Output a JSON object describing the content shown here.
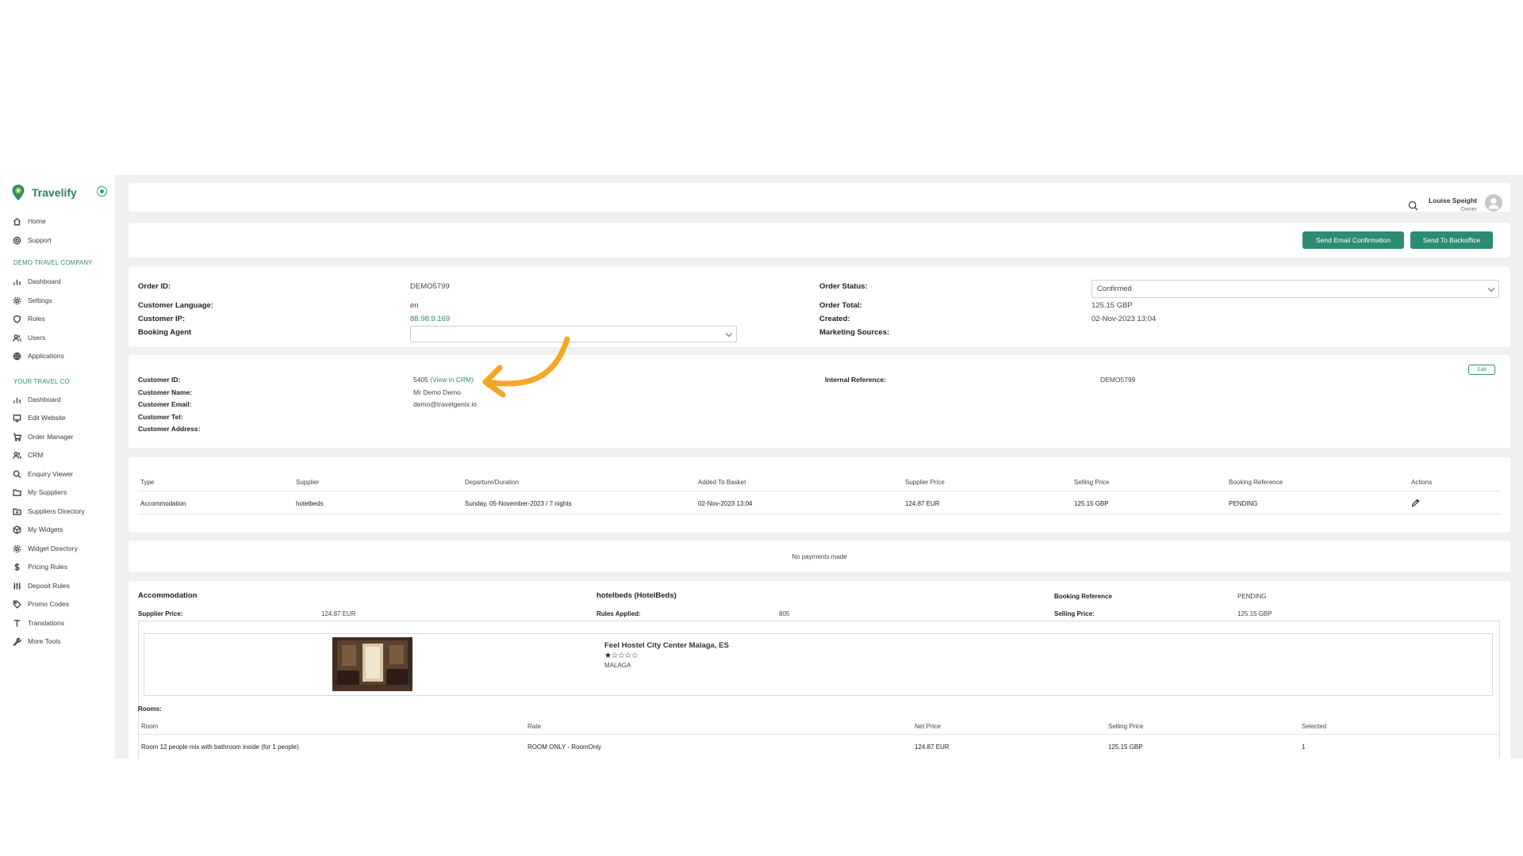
{
  "brand": {
    "name": "Travelify"
  },
  "sidebar": {
    "top_items": [
      {
        "label": "Home",
        "icon": "home-icon"
      },
      {
        "label": "Support",
        "icon": "support-icon"
      }
    ],
    "section1": {
      "title": "DEMO TRAVEL COMPANY",
      "items": [
        {
          "label": "Dashboard",
          "icon": "bar-chart-icon"
        },
        {
          "label": "Settings",
          "icon": "gear-icon"
        },
        {
          "label": "Roles",
          "icon": "shield-icon"
        },
        {
          "label": "Users",
          "icon": "users-icon"
        },
        {
          "label": "Applications",
          "icon": "globe-icon"
        }
      ]
    },
    "section2": {
      "title": "YOUR TRAVEL CO",
      "items": [
        {
          "label": "Dashboard",
          "icon": "bar-chart-icon"
        },
        {
          "label": "Edit Website",
          "icon": "monitor-icon"
        },
        {
          "label": "Order Manager",
          "icon": "cart-icon"
        },
        {
          "label": "CRM",
          "icon": "users-icon"
        },
        {
          "label": "Enquiry Viewer",
          "icon": "search-icon"
        },
        {
          "label": "My Suppliers",
          "icon": "folder-icon"
        },
        {
          "label": "Suppliers Directory",
          "icon": "folder-plus-icon"
        },
        {
          "label": "My Widgets",
          "icon": "box-icon"
        },
        {
          "label": "Widget Directory",
          "icon": "gear-box-icon"
        },
        {
          "label": "Pricing Rules",
          "icon": "dollar-icon"
        },
        {
          "label": "Deposit Rules",
          "icon": "sliders-icon"
        },
        {
          "label": "Promo Codes",
          "icon": "tag-icon"
        },
        {
          "label": "Translations",
          "icon": "type-icon"
        },
        {
          "label": "More Tools",
          "icon": "wrench-icon"
        }
      ]
    }
  },
  "header": {
    "user_name": "Louise Speight",
    "user_role": "Owner"
  },
  "actions": {
    "send_email": "Send Email Confirmation",
    "send_backoffice": "Send To Backoffice"
  },
  "order": {
    "order_id_label": "Order ID:",
    "order_id": "DEMO5799",
    "language_label": "Customer Language:",
    "language": "en",
    "ip_label": "Customer IP:",
    "ip": "88.98.9.169",
    "agent_label": "Booking Agent",
    "agent": "",
    "status_label": "Order Status:",
    "status": "Confirmed",
    "total_label": "Order Total:",
    "total": "125.15 GBP",
    "created_label": "Created:",
    "created": "02-Nov-2023 13:04",
    "marketing_label": "Marketing Sources:",
    "marketing": ""
  },
  "customer": {
    "id_label": "Customer ID:",
    "id": "5405",
    "view_crm": "(View in CRM)",
    "name_label": "Customer Name:",
    "name": "Mr Demo Demo",
    "email_label": "Customer Email:",
    "email": "demo@travelgenix.io",
    "tel_label": "Customer Tel:",
    "tel": "",
    "address_label": "Customer Address:",
    "address": "",
    "internal_ref_label": "Internal Reference:",
    "internal_ref": "DEMO5799",
    "edit_label": "Edit"
  },
  "items_table": {
    "headers": [
      "Type",
      "Supplier",
      "Departure/Duration",
      "Added To Basket",
      "Supplier Price",
      "Selling Price",
      "Booking Reference",
      "Actions"
    ],
    "rows": [
      [
        "Accommodation",
        "hotelbeds",
        "Sunday, 05-November-2023 / 7 nights",
        "02-Nov-2023 13:04",
        "124.87 EUR",
        "125.15 GBP",
        "PENDING",
        ""
      ]
    ]
  },
  "payments": {
    "message": "No payments made"
  },
  "accommodation": {
    "title": "Accommodation",
    "supplier_name": "hotelbeds (HotelBeds)",
    "booking_ref_label": "Booking Reference",
    "booking_ref": "PENDING",
    "supplier_price_label": "Supplier Price:",
    "supplier_price": "124.87 EUR",
    "rules_label": "Rules Applied:",
    "rules": "805",
    "selling_price_label": "Selling Price:",
    "selling_price": "125.15 GBP",
    "hotel_name": "Feel Hostel City Center Malaga, ES",
    "rating": 1,
    "stars": "★☆☆☆☆",
    "city": "MALAGA",
    "rooms_label": "Rooms:",
    "rooms_headers": [
      "Room",
      "Rate",
      "Net Price",
      "Selling Price",
      "Selected"
    ],
    "rooms": [
      [
        "Room 12 people mix with bathroom inside (for 1 people)",
        "ROOM ONLY - RoomOnly",
        "124.87 EUR",
        "125.15 GBP",
        "1"
      ]
    ]
  },
  "colors": {
    "accent": "#2d8c73",
    "arrow": "#f5a623",
    "background": "#eef0f1"
  }
}
